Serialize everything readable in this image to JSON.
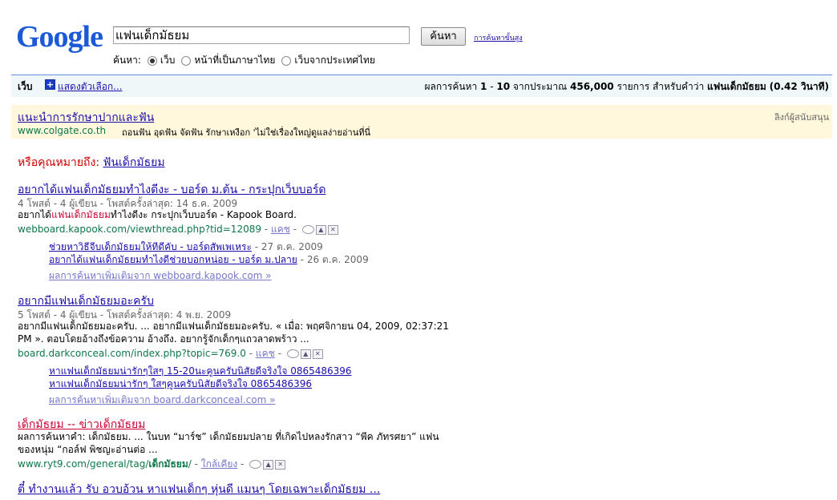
{
  "logo": "Google",
  "search": {
    "query": "แฟนเด็กมัธยม",
    "button": "ค้นหา",
    "advanced": "การค้นหาขั้นสูง"
  },
  "scope": {
    "label": "ค้นหา:",
    "options": [
      "เว็บ",
      "หน้าที่เป็นภาษาไทย",
      "เว็บจากประเทศไทย"
    ],
    "selected": 0
  },
  "bar": {
    "web": "เว็บ",
    "show_options": "แสดงตัวเลือก...",
    "stats_pre": "ผลการค้นหา ",
    "range_from": "1",
    "range_to": "10",
    "stats_mid": " จากประมาณ ",
    "count": "456,000",
    "stats_mid2": " รายการ สำหรับคำว่า ",
    "query": "แฟนเด็กมัธยม",
    "time": "(0.42 วินาที)"
  },
  "ad": {
    "title": "แนะนำการรักษาปากและฟัน",
    "sponsor": "ลิงก์ผู้สนับสนุน",
    "url": "www.colgate.co.th",
    "desc": "ถอนฟัน อุดฟัน จัดฟัน รักษาเหงือก 'ไม่ใช่เรื่องใหญ่ดูแลง่ายอ่านที่นี่"
  },
  "dym": {
    "label": "หรือคุณหมายถึง:",
    "suggestion": "ฟันเด็กมัธยม"
  },
  "results": [
    {
      "title": "อยากได้แฟนเด็กมัธยมทำไงดีงะ - บอร์ด ม.ต้น - กระปุกเว็บบอร์ด",
      "meta": "4 โพสต์ - 4 ผู้เขียน - โพสต์ครั้งล่าสุด: 14 ธ.ค. 2009",
      "snippet_a": "อยากได้",
      "snippet_em": "แฟนเด็กมัธยม",
      "snippet_b": "ทำไงดีงะ กระปุกเว็บบอร์ด - Kapook Board.",
      "url": "webboard.kapook.com/viewthread.php?tid=12089",
      "cached": "แคช",
      "sub": [
        {
          "title": "ช่วยหาวิธีจีบเด็กมัธยมให้ทีดีคับ - บอร์ดสัพเพเหระ",
          "date": "27 ต.ค. 2009"
        },
        {
          "title": "อยากได้แฟนเด็กมัธยมทำไงดีช่วยบอกหน่อย - บอร์ด ม.ปลาย",
          "date": "26 ต.ค. 2009"
        }
      ],
      "more": "ผลการค้นหาเพิ่มเติมจาก webboard.kapook.com »"
    },
    {
      "title": "อยากมีแฟนเด็กมัธยมอะครับ",
      "meta": "5 โพสต์ - 4 ผู้เขียน - โพสต์ครั้งล่าสุด: 4 พ.ย. 2009",
      "line1": "อยากมีแฟนเด็กมัธยมอะครับ. ... อยากมีแฟนเด็กมัธยมอะครับ. « เมื่อ: พฤศจิกายน 04, 2009, 02:37:21",
      "line2": "PM ». ตอบโดยอ้างถึงข้อความ อ้างถึง. อยากรู้จักเด็กๆแถวลาดพร้าว ...",
      "url": "board.darkconceal.com/index.php?topic=769.0",
      "cached": "แคช",
      "sub": [
        {
          "title": "หาแฟนเด็กมัธยมน่ารักๆใสๆ 15-20นะคูนครับนิสัยดีจริงใจ 0865486396"
        },
        {
          "title": "หาแฟนเด็กมัธยมน่ารักๆ ใสๆคูนครับนิสัยดีจริงใจ 0865486396"
        }
      ],
      "more": "ผลการค้นหาเพิ่มเติมจาก board.darkconceal.com »"
    },
    {
      "title": "เด็กมัธยม -- ข่าวเด็กมัธยม",
      "line1": "ผลการค้นหาคำ: เด็กมัธยม. ... ในบท “มาร์ช” เด็กมัธยมปลาย ที่เกิดไปหลงรักสาว “พีค ภัทรศยา” แฟน",
      "line2": "ของหนุ่ม “กอล์ฟ พิชญะอ่านต่อ ...",
      "url_a": "www.ryt9.com/general/tag/",
      "url_b": "เด็กมัธยม",
      "url_c": "/",
      "similar": "ใกล้เคียง"
    },
    {
      "title": "ตี๋ ทำงานแล้ว รับ อวบอ้วน หาแฟนเด็กๆ หุ่นดี แมนๆ โดยเฉพาะเด็กมัธยม ..."
    }
  ]
}
